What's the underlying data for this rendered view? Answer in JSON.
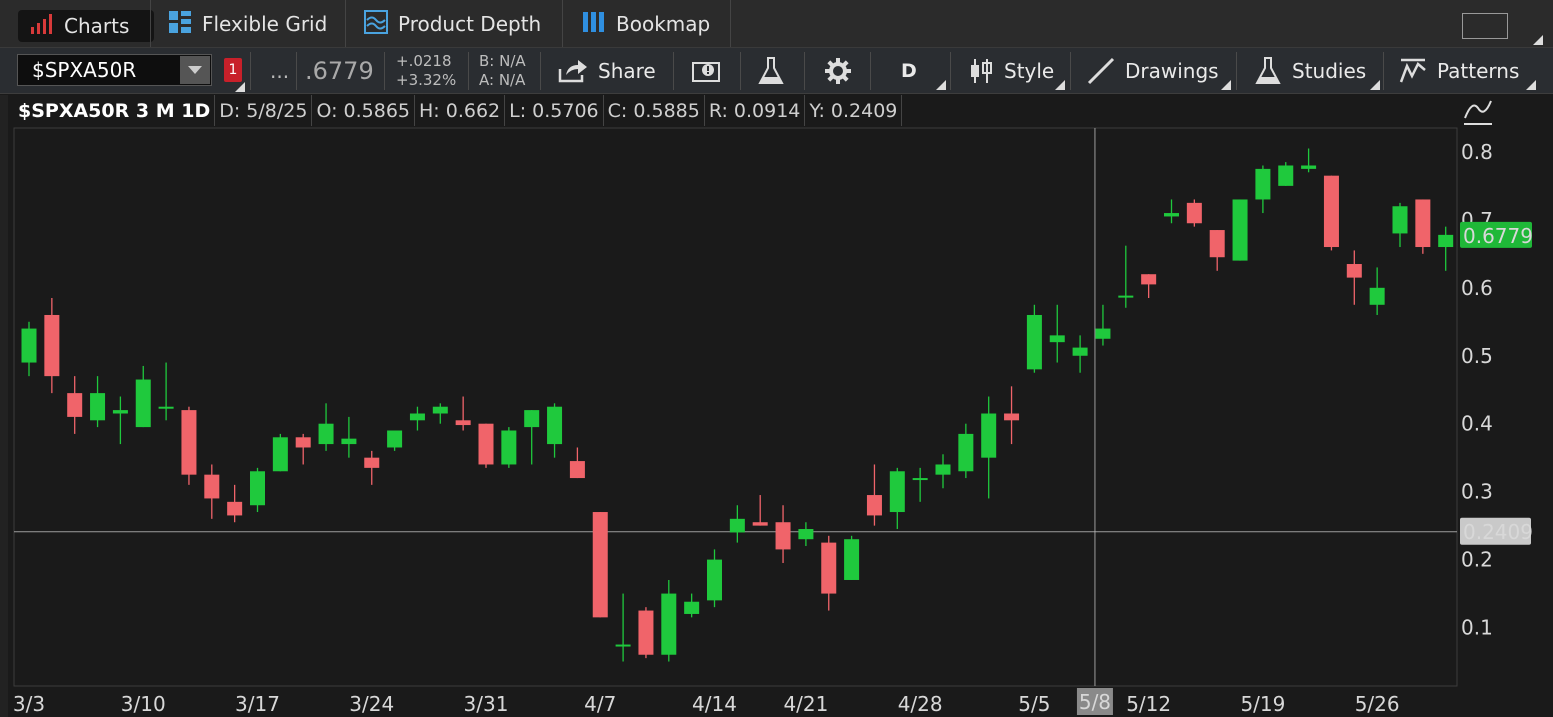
{
  "tabs": [
    {
      "label": "Charts",
      "icon": "bar-chart-icon",
      "active": true
    },
    {
      "label": "Flexible Grid",
      "icon": "grid-icon"
    },
    {
      "label": "Product Depth",
      "icon": "depth-icon"
    },
    {
      "label": "Bookmap",
      "icon": "bookmap-icon"
    }
  ],
  "toolbar": {
    "symbol": "$SPXA50R",
    "link_badge": "1",
    "ellipsis": "...",
    "last_price": ".6779",
    "net_change": "+.0218",
    "pct_change": "+3.32%",
    "bid": "B: N/A",
    "ask": "A: N/A",
    "share_label": "Share",
    "aggregation": "D",
    "style_label": "Style",
    "drawings_label": "Drawings",
    "studies_label": "Studies",
    "patterns_label": "Patterns"
  },
  "info": {
    "title": "$SPXA50R 3 M 1D",
    "date": "D: 5/8/25",
    "open": "O: 0.5865",
    "high": "H: 0.662",
    "low": "L: 0.5706",
    "close": "C: 0.5885",
    "range": "R: 0.0914",
    "y": "Y: 0.2409"
  },
  "colors": {
    "up": "#1fc93d",
    "down": "#f0646a",
    "price_tag": "#1fb838",
    "crosshair": "#bdbdbd"
  },
  "chart_data": {
    "type": "candlestick",
    "title": "$SPXA50R 3 M 1D",
    "ylim": [
      0.03,
      0.85
    ],
    "yticks": [
      0.1,
      0.2,
      0.3,
      0.4,
      0.5,
      0.6,
      0.7,
      0.8
    ],
    "ytick_labels": [
      "0.1",
      "0.2",
      "0.3",
      "0.4",
      "0.5",
      "0.6",
      "0.7",
      "0.8"
    ],
    "xtick_labels": [
      {
        "label": "3/3",
        "index": 0
      },
      {
        "label": "3/10",
        "index": 5
      },
      {
        "label": "3/17",
        "index": 10
      },
      {
        "label": "3/24",
        "index": 15
      },
      {
        "label": "3/31",
        "index": 20
      },
      {
        "label": "4/7",
        "index": 25
      },
      {
        "label": "4/14",
        "index": 30
      },
      {
        "label": "4/21",
        "index": 34
      },
      {
        "label": "4/28",
        "index": 39
      },
      {
        "label": "5/5",
        "index": 44
      },
      {
        "label": "5/12",
        "index": 49
      },
      {
        "label": "5/19",
        "index": 54
      },
      {
        "label": "5/26",
        "index": 59
      }
    ],
    "crosshair": {
      "x_label": "5/8",
      "x_index": 47,
      "y_value": 0.2409,
      "y_label": "0.2409"
    },
    "last_price": {
      "value": 0.6779,
      "label": "0.6779"
    },
    "candles": [
      {
        "o": 0.49,
        "h": 0.55,
        "l": 0.47,
        "c": 0.54
      },
      {
        "o": 0.56,
        "h": 0.585,
        "l": 0.445,
        "c": 0.47
      },
      {
        "o": 0.445,
        "h": 0.47,
        "l": 0.385,
        "c": 0.41
      },
      {
        "o": 0.405,
        "h": 0.47,
        "l": 0.395,
        "c": 0.445
      },
      {
        "o": 0.415,
        "h": 0.44,
        "l": 0.37,
        "c": 0.42
      },
      {
        "o": 0.395,
        "h": 0.485,
        "l": 0.395,
        "c": 0.465
      },
      {
        "o": 0.425,
        "h": 0.49,
        "l": 0.405,
        "c": 0.425
      },
      {
        "o": 0.42,
        "h": 0.425,
        "l": 0.31,
        "c": 0.325
      },
      {
        "o": 0.325,
        "h": 0.34,
        "l": 0.26,
        "c": 0.29
      },
      {
        "o": 0.285,
        "h": 0.31,
        "l": 0.255,
        "c": 0.265
      },
      {
        "o": 0.28,
        "h": 0.335,
        "l": 0.27,
        "c": 0.33
      },
      {
        "o": 0.33,
        "h": 0.385,
        "l": 0.33,
        "c": 0.38
      },
      {
        "o": 0.38,
        "h": 0.385,
        "l": 0.34,
        "c": 0.365
      },
      {
        "o": 0.37,
        "h": 0.43,
        "l": 0.36,
        "c": 0.4
      },
      {
        "o": 0.37,
        "h": 0.41,
        "l": 0.35,
        "c": 0.378
      },
      {
        "o": 0.35,
        "h": 0.36,
        "l": 0.31,
        "c": 0.335
      },
      {
        "o": 0.365,
        "h": 0.39,
        "l": 0.36,
        "c": 0.39
      },
      {
        "o": 0.405,
        "h": 0.425,
        "l": 0.39,
        "c": 0.415
      },
      {
        "o": 0.415,
        "h": 0.43,
        "l": 0.4,
        "c": 0.425
      },
      {
        "o": 0.405,
        "h": 0.44,
        "l": 0.39,
        "c": 0.398
      },
      {
        "o": 0.4,
        "h": 0.4,
        "l": 0.335,
        "c": 0.34
      },
      {
        "o": 0.34,
        "h": 0.395,
        "l": 0.335,
        "c": 0.39
      },
      {
        "o": 0.395,
        "h": 0.42,
        "l": 0.34,
        "c": 0.42
      },
      {
        "o": 0.37,
        "h": 0.43,
        "l": 0.35,
        "c": 0.425
      },
      {
        "o": 0.345,
        "h": 0.365,
        "l": 0.32,
        "c": 0.32
      },
      {
        "o": 0.27,
        "h": 0.27,
        "l": 0.115,
        "c": 0.115
      },
      {
        "o": 0.075,
        "h": 0.15,
        "l": 0.05,
        "c": 0.075
      },
      {
        "o": 0.125,
        "h": 0.13,
        "l": 0.055,
        "c": 0.06
      },
      {
        "o": 0.06,
        "h": 0.17,
        "l": 0.05,
        "c": 0.15
      },
      {
        "o": 0.12,
        "h": 0.15,
        "l": 0.115,
        "c": 0.138
      },
      {
        "o": 0.14,
        "h": 0.215,
        "l": 0.13,
        "c": 0.2
      },
      {
        "o": 0.24,
        "h": 0.28,
        "l": 0.225,
        "c": 0.26
      },
      {
        "o": 0.255,
        "h": 0.295,
        "l": 0.25,
        "c": 0.25
      },
      {
        "o": 0.255,
        "h": 0.28,
        "l": 0.195,
        "c": 0.215
      },
      {
        "o": 0.23,
        "h": 0.255,
        "l": 0.22,
        "c": 0.245
      },
      {
        "o": 0.225,
        "h": 0.235,
        "l": 0.125,
        "c": 0.15
      },
      {
        "o": 0.17,
        "h": 0.235,
        "l": 0.17,
        "c": 0.23
      },
      {
        "o": 0.295,
        "h": 0.34,
        "l": 0.25,
        "c": 0.265
      },
      {
        "o": 0.27,
        "h": 0.335,
        "l": 0.245,
        "c": 0.33
      },
      {
        "o": 0.32,
        "h": 0.335,
        "l": 0.285,
        "c": 0.32
      },
      {
        "o": 0.325,
        "h": 0.355,
        "l": 0.305,
        "c": 0.34
      },
      {
        "o": 0.33,
        "h": 0.4,
        "l": 0.32,
        "c": 0.385
      },
      {
        "o": 0.35,
        "h": 0.44,
        "l": 0.29,
        "c": 0.415
      },
      {
        "o": 0.415,
        "h": 0.455,
        "l": 0.37,
        "c": 0.405
      },
      {
        "o": 0.48,
        "h": 0.575,
        "l": 0.475,
        "c": 0.56
      },
      {
        "o": 0.52,
        "h": 0.575,
        "l": 0.49,
        "c": 0.53
      },
      {
        "o": 0.5,
        "h": 0.53,
        "l": 0.475,
        "c": 0.512
      },
      {
        "o": 0.525,
        "h": 0.575,
        "l": 0.515,
        "c": 0.54
      },
      {
        "o": 0.5865,
        "h": 0.662,
        "l": 0.5706,
        "c": 0.5885
      },
      {
        "o": 0.62,
        "h": 0.62,
        "l": 0.585,
        "c": 0.605
      },
      {
        "o": 0.705,
        "h": 0.73,
        "l": 0.695,
        "c": 0.71
      },
      {
        "o": 0.725,
        "h": 0.73,
        "l": 0.69,
        "c": 0.695
      },
      {
        "o": 0.685,
        "h": 0.685,
        "l": 0.625,
        "c": 0.645
      },
      {
        "o": 0.64,
        "h": 0.73,
        "l": 0.64,
        "c": 0.73
      },
      {
        "o": 0.73,
        "h": 0.78,
        "l": 0.71,
        "c": 0.775
      },
      {
        "o": 0.75,
        "h": 0.785,
        "l": 0.75,
        "c": 0.78
      },
      {
        "o": 0.775,
        "h": 0.805,
        "l": 0.77,
        "c": 0.78
      },
      {
        "o": 0.765,
        "h": 0.765,
        "l": 0.655,
        "c": 0.66
      },
      {
        "o": 0.635,
        "h": 0.655,
        "l": 0.575,
        "c": 0.615
      },
      {
        "o": 0.575,
        "h": 0.63,
        "l": 0.56,
        "c": 0.6
      },
      {
        "o": 0.68,
        "h": 0.725,
        "l": 0.66,
        "c": 0.72
      },
      {
        "o": 0.73,
        "h": 0.73,
        "l": 0.65,
        "c": 0.66
      },
      {
        "o": 0.66,
        "h": 0.69,
        "l": 0.625,
        "c": 0.6779
      }
    ]
  }
}
